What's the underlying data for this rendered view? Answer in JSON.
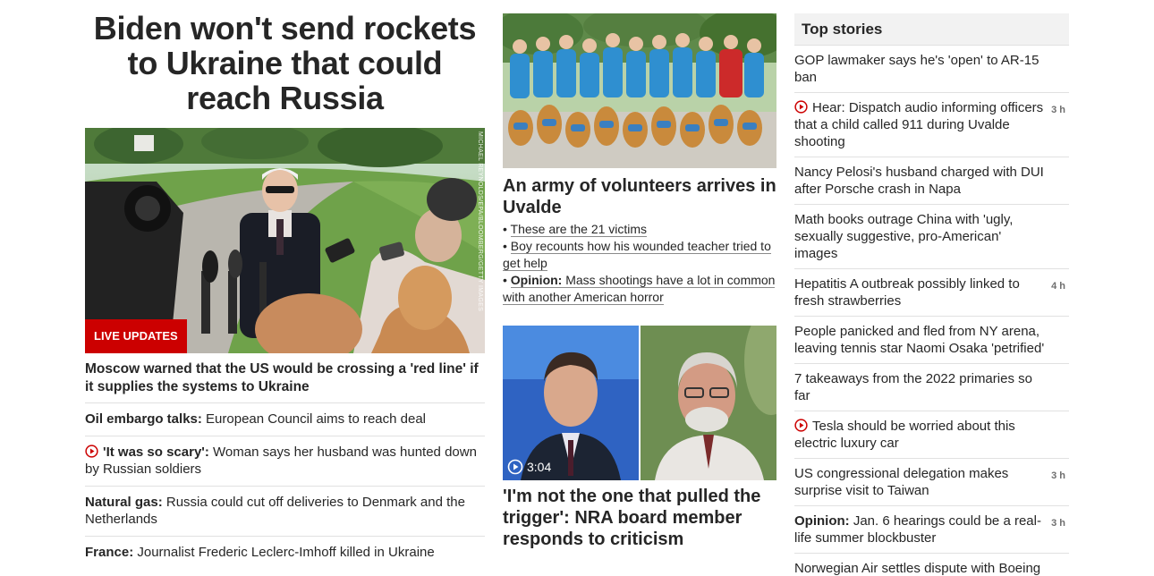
{
  "lead_story": {
    "headline": "Biden won't send rockets to Ukraine that could reach Russia",
    "badge": "LIVE UPDATES",
    "photo_credit": "MICHAEL REYNOLDS/EPA/BLOOMBERG/GETTY IMAGES",
    "items": [
      {
        "prefix": "",
        "text": "Moscow warned that the US would be crossing a 'red line' if it supplies the systems to Ukraine",
        "video": false
      },
      {
        "prefix": "Oil embargo talks:",
        "text": " European Council aims to reach deal",
        "video": false
      },
      {
        "prefix": "'It was so scary':",
        "text": " Woman says her husband was hunted down by Russian soldiers",
        "video": true
      },
      {
        "prefix": "Natural gas:",
        "text": " Russia could cut off deliveries to Denmark and the Netherlands",
        "video": false
      },
      {
        "prefix": "France:",
        "text": " Journalist Frederic Leclerc-Imhoff killed in Ukraine",
        "video": false
      }
    ]
  },
  "middle": {
    "story1": {
      "title": "An army of volunteers arrives in Uvalde",
      "bullets": [
        {
          "prefix": "",
          "text": "These are the 21 victims"
        },
        {
          "prefix": "",
          "text": "Boy recounts how his wounded teacher tried to get help"
        },
        {
          "prefix": "Opinion:",
          "text": " Mass shootings have a lot in common with another American horror"
        }
      ]
    },
    "story2": {
      "duration": "3:04",
      "title": "'I'm not the one that pulled the trigger': NRA board member responds to criticism"
    }
  },
  "top_stories": {
    "heading": "Top stories",
    "items": [
      {
        "prefix": "",
        "text": "GOP lawmaker says he's 'open' to AR-15 ban",
        "time": "",
        "video": false
      },
      {
        "prefix": "",
        "text": "Hear: Dispatch audio informing officers that a child called 911 during Uvalde shooting",
        "time": "3 h",
        "video": true
      },
      {
        "prefix": "",
        "text": "Nancy Pelosi's husband charged with DUI after Porsche crash in Napa",
        "time": "",
        "video": false
      },
      {
        "prefix": "",
        "text": "Math books outrage China with 'ugly, sexually suggestive, pro-American' images",
        "time": "",
        "video": false
      },
      {
        "prefix": "",
        "text": "Hepatitis A outbreak possibly linked to fresh strawberries",
        "time": "4 h",
        "video": false
      },
      {
        "prefix": "",
        "text": "People panicked and fled from NY arena, leaving tennis star Naomi Osaka 'petrified'",
        "time": "",
        "video": false
      },
      {
        "prefix": "",
        "text": "7 takeaways from the 2022 primaries so far",
        "time": "",
        "video": false
      },
      {
        "prefix": "",
        "text": "Tesla should be worried about this electric luxury car",
        "time": "",
        "video": true
      },
      {
        "prefix": "",
        "text": "US congressional delegation makes surprise visit to Taiwan",
        "time": "3 h",
        "video": false
      },
      {
        "prefix": "Opinion:",
        "text": " Jan. 6 hearings could be a real-life summer blockbuster",
        "time": "3 h",
        "video": false
      },
      {
        "prefix": "",
        "text": "Norwegian Air settles dispute with Boeing",
        "time": "",
        "video": false
      }
    ]
  },
  "colors": {
    "accent": "#cc0000",
    "text": "#262626",
    "muted": "#6e6e6e",
    "divider": "#e1e1e1",
    "header_bg": "#f2f2f2"
  },
  "icons": [
    "play-circle-icon"
  ]
}
